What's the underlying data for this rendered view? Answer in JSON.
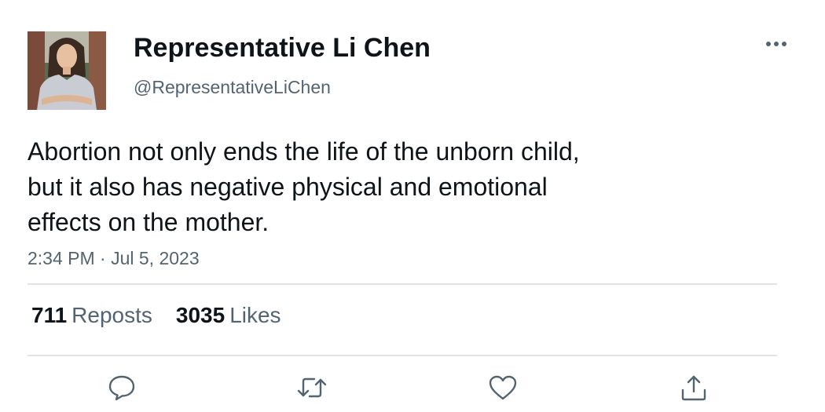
{
  "author": {
    "display_name": "Representative Li Chen",
    "handle": "@RepresentativeLiChen"
  },
  "tweet": {
    "text_lines": [
      "Abortion not only ends the life of the unborn child,",
      "but it also has negative physical and emotional",
      "effects on the mother."
    ],
    "timestamp": "2:34 PM · Jul 5, 2023"
  },
  "stats": {
    "reposts_count": "711",
    "reposts_label": "Reposts",
    "likes_count": "3035",
    "likes_label": "Likes"
  },
  "actions": [
    "reply-icon",
    "repost-icon",
    "like-icon",
    "share-icon"
  ],
  "colors": {
    "text_primary": "#0f1419",
    "text_secondary": "#536471",
    "divider": "#e1e4e6",
    "icon": "#536471"
  }
}
